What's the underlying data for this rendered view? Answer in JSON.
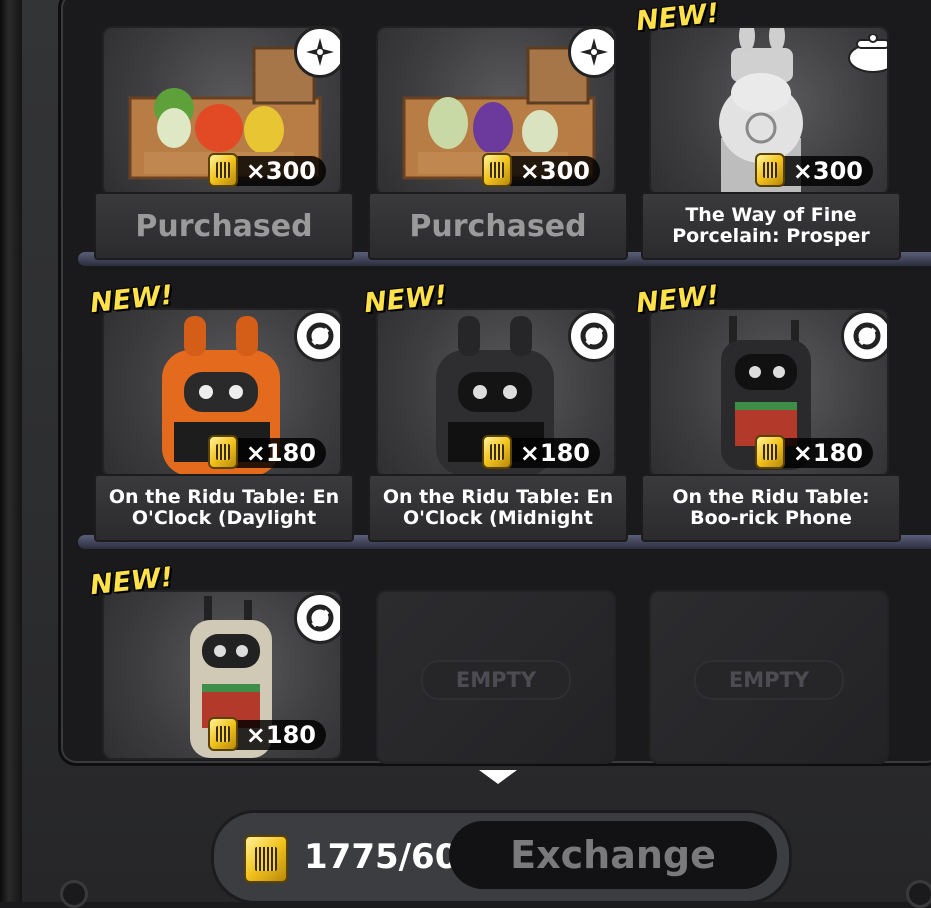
{
  "cards": [
    {
      "new": false,
      "badge": "shuriken-icon",
      "price": "×300",
      "label": "Purchased",
      "purchased": true
    },
    {
      "new": false,
      "badge": "shuriken-icon",
      "price": "×300",
      "label": "Purchased",
      "purchased": true
    },
    {
      "new": true,
      "new_text": "NEW!",
      "badge": "pot-icon",
      "price": "×300",
      "label": "The Way of Fine Porcelain: Prosper"
    },
    {
      "new": true,
      "new_text": "NEW!",
      "badge": "link-icon",
      "price": "×180",
      "label": "On the Ridu Table: En O'Clock (Daylight"
    },
    {
      "new": true,
      "new_text": "NEW!",
      "badge": "link-icon",
      "price": "×180",
      "label": "On the Ridu Table: En O'Clock (Midnight"
    },
    {
      "new": true,
      "new_text": "NEW!",
      "badge": "link-icon",
      "price": "×180",
      "label": "On the Ridu Table: Boo-rick Phone"
    },
    {
      "new": true,
      "new_text": "NEW!",
      "badge": "link-icon",
      "price": "×180",
      "label": ""
    },
    {
      "empty_label": "EMPTY"
    },
    {
      "empty_label": "EMPTY"
    }
  ],
  "footer": {
    "balance": "1775/60",
    "exchange_label": "Exchange"
  },
  "colors": {
    "new_tag": "#ffe14a",
    "shelf": "#5a5e78",
    "purchased_text": "#9a9a9a"
  }
}
